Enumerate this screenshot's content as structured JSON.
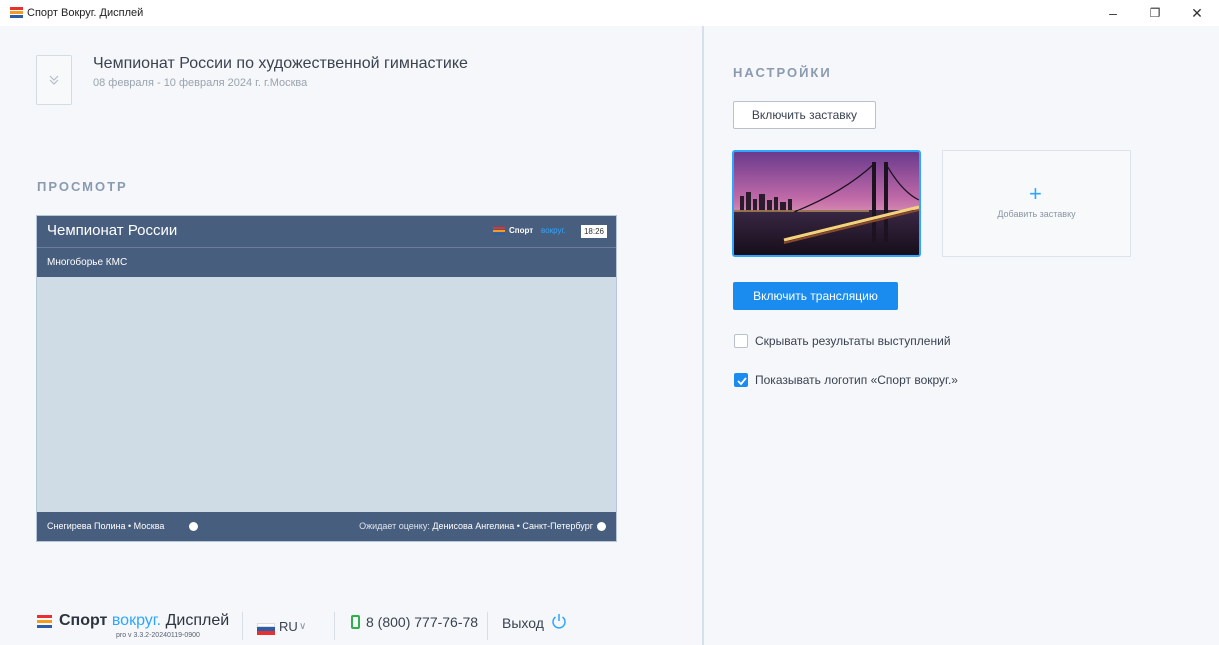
{
  "window": {
    "title": "Спорт Вокруг. Дисплей",
    "minimize": "–",
    "restore": "❐",
    "close": "✕"
  },
  "event": {
    "title": "Чемпионат России по художественной гимнастике",
    "dates": "08 февраля - 10 февраля 2024 г. г.Москва"
  },
  "preview": {
    "section_title": "ПРОСМОТР",
    "header_title": "Чемпионат России",
    "brand_main": "Спорт",
    "brand_accent": "вокруг.",
    "time": "18:26",
    "subheader": "Многоборье КМС",
    "current_athlete": "Снегирева Полина • Москва",
    "waiting_prefix": "Ожидает оценку:",
    "waiting_athlete": "Денисова Ангелина • Санкт-Петербург"
  },
  "settings": {
    "section_title": "НАСТРОЙКИ",
    "screensaver_button": "Включить заставку",
    "add_screensaver": "Добавить заставку",
    "add_plus": "+",
    "broadcast_button": "Включить трансляцию",
    "hide_results_label": "Скрывать результаты выступлений",
    "hide_results_checked": false,
    "show_logo_label": "Показывать логотип «Спорт вокруг.»",
    "show_logo_checked": true
  },
  "footer": {
    "brand_main": "Спорт",
    "brand_accent": "вокруг.",
    "brand_product": "Дисплей",
    "version": "pro v 3.3.2-20240119-0900",
    "language": "RU",
    "phone": "8 (800) 777-76-78",
    "exit": "Выход"
  },
  "colors": {
    "accent": "#2ea6ff",
    "primary_button": "#1a8cf0",
    "preview_bar": "#485e7e",
    "preview_body": "#cfdbe5",
    "logo_red": "#e8312f",
    "logo_orange": "#f39c1f",
    "logo_blue": "#2c5ea8"
  },
  "icons": [
    "app-logo-icon",
    "chevron-down-double-icon",
    "plus-icon",
    "checkmark-icon",
    "russia-flag-icon",
    "phone-icon",
    "power-icon"
  ]
}
